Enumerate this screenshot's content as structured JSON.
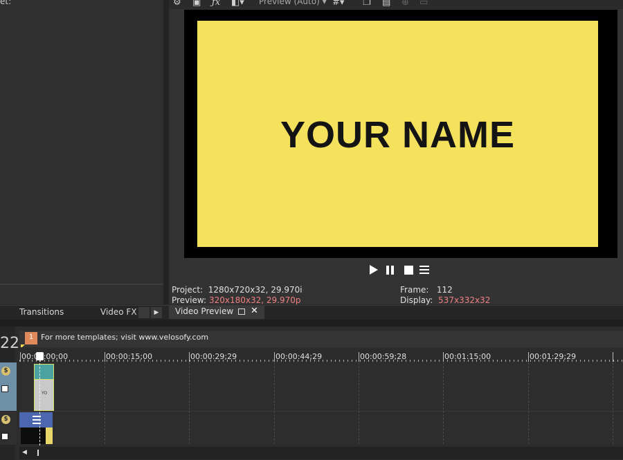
{
  "left_panel": {
    "title": "et:"
  },
  "dock_tabs": [
    {
      "label": "Transitions"
    },
    {
      "label": "Video FX"
    }
  ],
  "preview": {
    "mode_label": "Preview (Auto)",
    "frame_text": "YOUR NAME",
    "frame_color": "#f4e15c",
    "info": {
      "project_label": "Project:",
      "project_value": "1280x720x32, 29.970i",
      "preview_label": "Preview:",
      "preview_value": "320x180x32, 29.970p",
      "frame_label": "Frame:",
      "frame_value": "112",
      "display_label": "Display:",
      "display_value": "537x332x32"
    },
    "tab_label": "Video Preview"
  },
  "timeline": {
    "counter_partial": "22",
    "region_marker_number": "1",
    "region_marker_text": "For more templates; visit www.velosofy.com",
    "ruler_labels": [
      "00:00:00;00",
      "00:00:15;00",
      "00:00:29;29",
      "00:00:44;29",
      "00:00:59;28",
      "00:01:15;00",
      "00:01:29;29"
    ],
    "clip_label": "YO"
  },
  "colors": {
    "accent_marker": "#e0895a",
    "highlight_value": "#f08080",
    "video_track_header": "#6f8fa6",
    "audio_clip": "#4c66b0"
  }
}
